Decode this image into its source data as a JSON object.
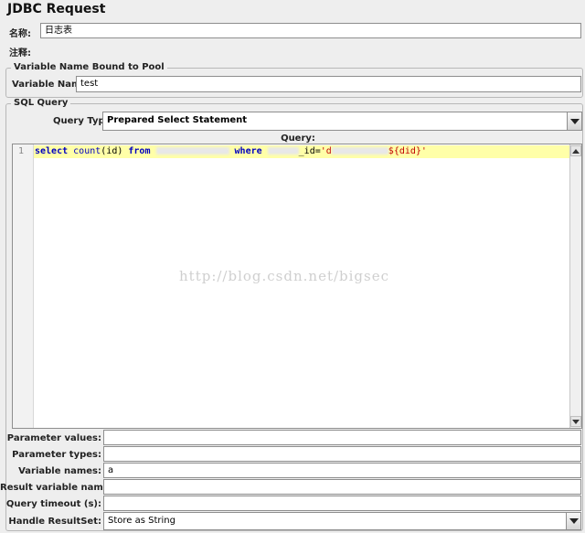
{
  "panel_title": "JDBC Request",
  "name": {
    "label": "名称:",
    "value": "日志表"
  },
  "comment": {
    "label": "注释:",
    "value": ""
  },
  "pool_group": {
    "legend": "Variable Name Bound to Pool",
    "label": "Variable Name:",
    "value": "test"
  },
  "sql_group": {
    "legend": "SQL Query",
    "query_type_label": "Query Type:",
    "query_type_value": "Prepared Select Statement",
    "query_header": "Query:",
    "editor": {
      "line_number": "1",
      "tokens": [
        {
          "text": "select ",
          "kind": "kw"
        },
        {
          "text": "count",
          "kind": "fn"
        },
        {
          "text": "(",
          "kind": "plain"
        },
        {
          "text": "id",
          "kind": "plain"
        },
        {
          "text": ") ",
          "kind": "plain"
        },
        {
          "text": "from ",
          "kind": "kw"
        },
        {
          "text": "where ",
          "kind": "kw"
        },
        {
          "text": "_id=",
          "kind": "plain"
        },
        {
          "text": "'d",
          "kind": "str"
        },
        {
          "text": "${did}'",
          "kind": "str"
        }
      ]
    }
  },
  "watermark": "http://blog.csdn.net/bigsec",
  "params": [
    {
      "label": "Parameter values:",
      "value": ""
    },
    {
      "label": "Parameter types:",
      "value": ""
    },
    {
      "label": "Variable names:",
      "value": "a"
    },
    {
      "label": "Result variable name:",
      "value": ""
    },
    {
      "label": "Query timeout (s):",
      "value": ""
    }
  ],
  "handle_resultset": {
    "label": "Handle ResultSet:",
    "value": "Store as String"
  },
  "colors": {
    "background": "#eeeeee",
    "keyword": "#0000c0",
    "string": "#c00000",
    "line_highlight": "#ffffa8"
  },
  "icons": {
    "dropdown": "chevron-down-icon",
    "scroll_up": "scroll-up-arrow-icon",
    "scroll_down": "scroll-down-arrow-icon"
  }
}
